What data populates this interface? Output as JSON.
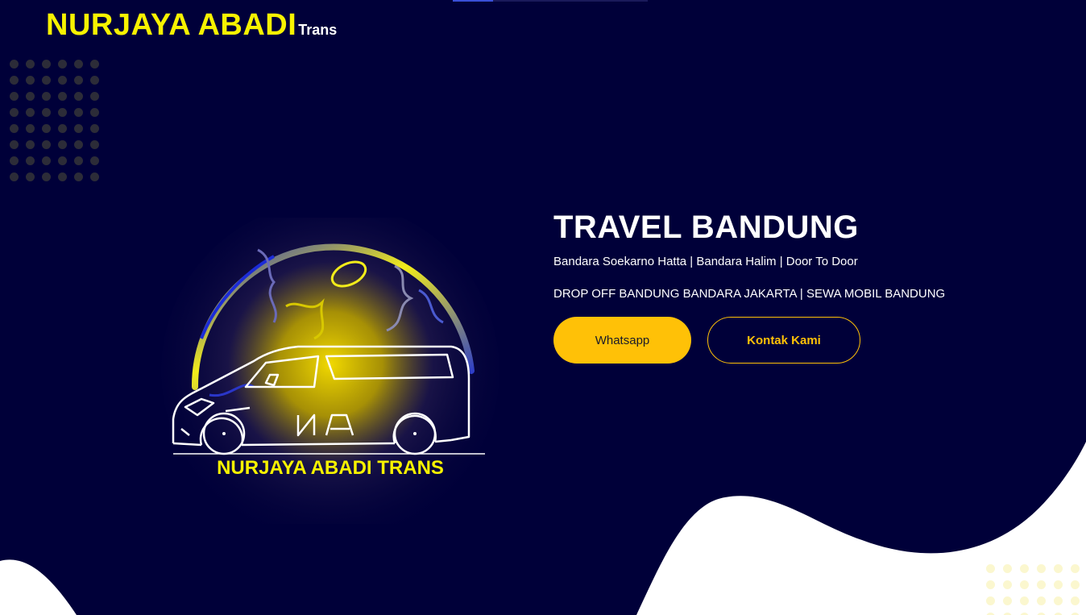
{
  "brand": {
    "name": "NURJAYA ABADI",
    "suffix": "Trans"
  },
  "hero": {
    "title": "TRAVEL BANDUNG",
    "subtitle": "Bandara Soekarno Hatta | Bandara Halim | Door To Door",
    "subtitle2": "DROP OFF BANDUNG BANDARA JAKARTA | SEWA MOBIL BANDUNG",
    "whatsapp_label": "Whatsapp",
    "kontak_label": "Kontak Kami"
  },
  "logo": {
    "caption": "NURJAYA ABADI TRANS",
    "monogram": "NA"
  },
  "colors": {
    "background": "#000039",
    "brand_yellow": "#f7f200",
    "button_yellow": "#ffc107",
    "wave": "#ffffff"
  }
}
